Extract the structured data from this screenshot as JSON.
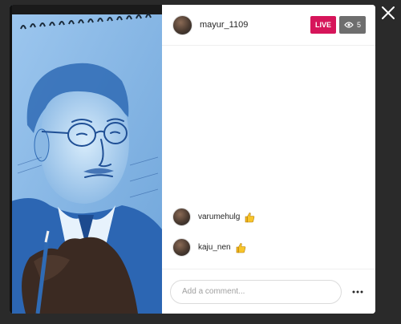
{
  "broadcaster": {
    "username": "mayur_1109"
  },
  "live_badge": "LIVE",
  "viewer_count": "5",
  "comments": [
    {
      "username": "varumehulg",
      "reaction": "thumbs-up-emoji"
    },
    {
      "username": "kaju_nen",
      "reaction": "thumbs-up-emoji"
    }
  ],
  "composer": {
    "placeholder": "Add a comment..."
  },
  "icons": {
    "close": "close-icon",
    "viewers": "eye-icon",
    "more": "more-options-icon"
  },
  "colors": {
    "live_badge": "#d6155a",
    "viewers_badge": "#6e6e6e",
    "backdrop": "#2a2a2a"
  }
}
